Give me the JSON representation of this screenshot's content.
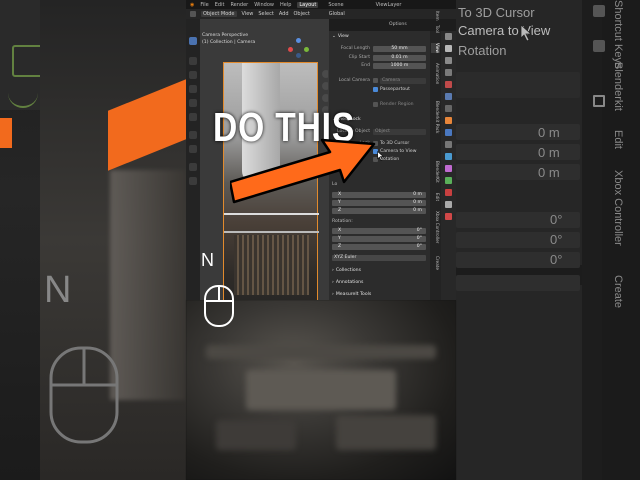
{
  "blender": {
    "top_menu": [
      "File",
      "Edit",
      "Render",
      "Window",
      "Help"
    ],
    "workspace_tab": "Layout",
    "scene_label": "Scene",
    "view_layer_label": "ViewLayer",
    "header": {
      "mode": "Object Mode",
      "menus": [
        "View",
        "Select",
        "Add",
        "Object"
      ],
      "orientation": "Global",
      "options_label": "Options"
    },
    "viewport": {
      "title": "Camera Perspective",
      "subtitle": "(1) Collection | Camera"
    }
  },
  "npanel": {
    "view_section": "View",
    "focal_length_label": "Focal Length",
    "focal_length_value": "50 mm",
    "clip_start_label": "Clip Start",
    "clip_start_value": "0.01 m",
    "clip_end_label": "End",
    "clip_end_value": "1000 m",
    "local_camera_label": "Local Camera",
    "local_camera_value": "Camera",
    "passepartout_label": "Passepartout",
    "render_region_label": "Render Region",
    "view_lock_section": "View Lock",
    "lock_to_object_label": "Lock to Object",
    "lock_to_object_value": "Object",
    "lock_label": "Lock",
    "to_3d_cursor_label": "To 3D Cursor",
    "camera_to_view_label": "Camera to View",
    "rotation_label": "Rotation",
    "location_label": "Lo",
    "location": [
      {
        "axis": "X",
        "value": "0 m"
      },
      {
        "axis": "Y",
        "value": "0 m"
      },
      {
        "axis": "Z",
        "value": "0 m"
      }
    ],
    "rotation_section_label": "Rotation:",
    "rotation": [
      {
        "axis": "X",
        "value": "0°"
      },
      {
        "axis": "Y",
        "value": "0°"
      },
      {
        "axis": "Z",
        "value": "0°"
      }
    ],
    "rotation_mode": "XYZ Euler",
    "collections_label": "Collections",
    "annotations_label": "Annotations",
    "measureit_label": "MeasureIt Tools"
  },
  "sidebar_tabs": [
    "Item",
    "Tool",
    "View",
    "Animation",
    "Blenderkit Pack",
    "BlenderKit",
    "Edit",
    "Xbox Controller",
    "Create"
  ],
  "overlay": {
    "do_this": "DO THIS",
    "n_key": "N",
    "n_key_large": "N"
  },
  "background_right": {
    "to_3d_cursor": "To 3D Cursor",
    "camera_to_view": "Camera to View",
    "rotation": "Rotation",
    "values": [
      "0 m",
      "0 m",
      "0 m",
      "0°",
      "0°",
      "0°"
    ],
    "tab_labels": [
      "Shortcut Keys",
      "Blenderkit",
      "Edit",
      "Xbox Controller",
      "Create"
    ]
  },
  "colors": {
    "arrow": "#ff6a1a",
    "accent_blue": "#4a8ad9",
    "camera_frame": "#e28a2c"
  }
}
